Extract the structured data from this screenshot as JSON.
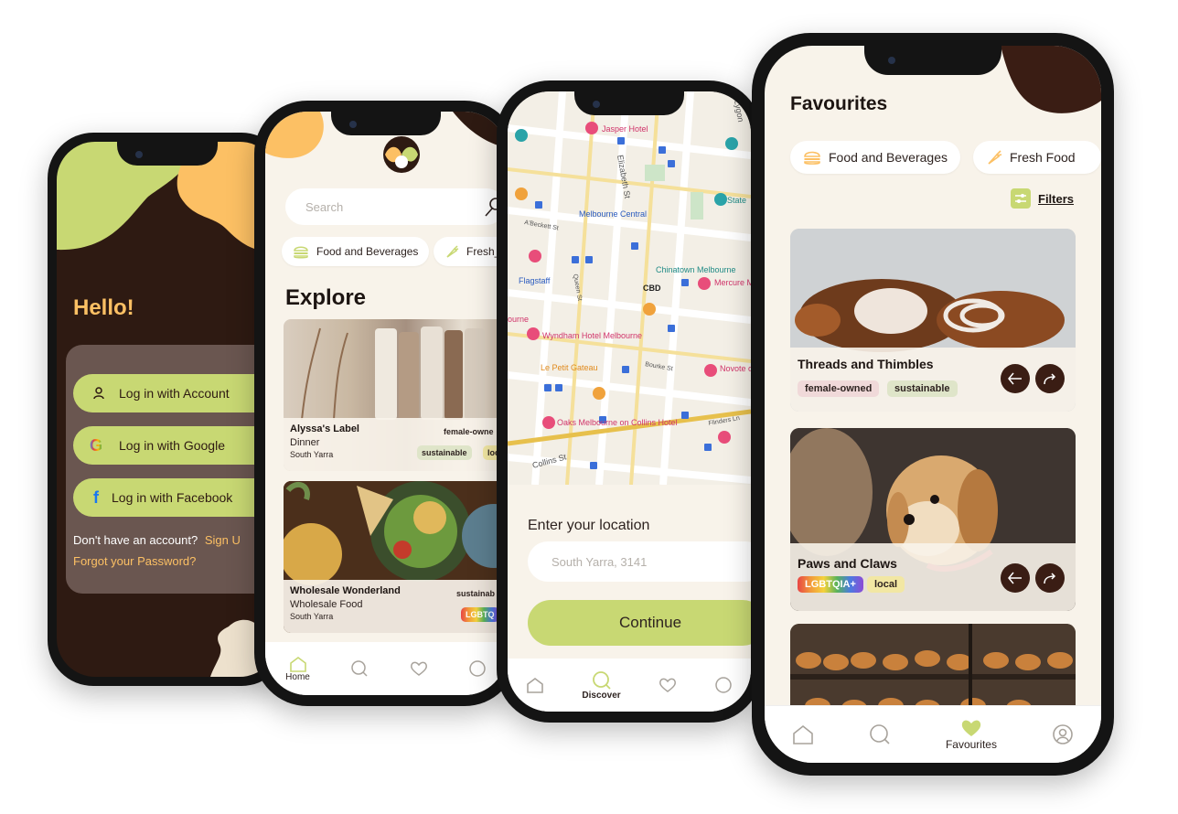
{
  "login": {
    "greeting": "Hello!",
    "buttons": [
      {
        "label": "Log in with Account",
        "icon": "user-icon"
      },
      {
        "label": "Log in with Google",
        "icon": "google-icon"
      },
      {
        "label": "Log in with Facebook",
        "icon": "facebook-icon"
      }
    ],
    "no_account": "Don't have an account?",
    "sign_up": "Sign U",
    "forgot": "Forgot your Password?"
  },
  "explore": {
    "search_placeholder": "Search",
    "chips": [
      "Food and Beverages",
      "Fresh_"
    ],
    "title": "Explore",
    "cards": [
      {
        "name": "Alyssa's Label",
        "category": "Dinner",
        "location": "South Yarra",
        "tags": [
          "female-owne",
          "sustainable",
          "loc"
        ]
      },
      {
        "name": "Wholesale Wonderland",
        "category": "Wholesale Food",
        "location": "South Yarra",
        "tags": [
          "sustainab",
          "LGBTQ"
        ]
      }
    ],
    "nav": {
      "home": "Home"
    }
  },
  "discover": {
    "map_labels": [
      "Jasper Hotel",
      "Elizabeth St",
      "Melbourne Central",
      "Flagstaff",
      "CBD",
      "Chinatown Melbourne",
      "Mercure Melbour",
      "ourne",
      "Wyndham Hotel Melbourne",
      "Le Petit Gateau",
      "Novote on Collin",
      "Oaks Melbourne on Collins Hotel",
      "Collins St",
      "State",
      "Lygon",
      "Queen St",
      "Bourke St",
      "Flinders Ln",
      "A'Beckett St"
    ],
    "location_label": "Enter your location",
    "location_placeholder": "South Yarra, 3141",
    "continue": "Continue",
    "nav": {
      "discover": "Discover"
    }
  },
  "favourites": {
    "title": "Favourites",
    "chips": [
      "Food and Beverages",
      "Fresh Food"
    ],
    "filters": "Filters",
    "cards": [
      {
        "name": "Threads and Thimbles",
        "tags": [
          "female-owned",
          "sustainable"
        ]
      },
      {
        "name": "Paws and Claws",
        "tags": [
          "LGBTQIA+",
          "local"
        ]
      }
    ],
    "nav": {
      "favourites": "Favourites"
    }
  },
  "colors": {
    "dark_brown": "#2e1a12",
    "green": "#c8d873",
    "orange": "#fcc064",
    "cream": "#f8f3ea"
  }
}
